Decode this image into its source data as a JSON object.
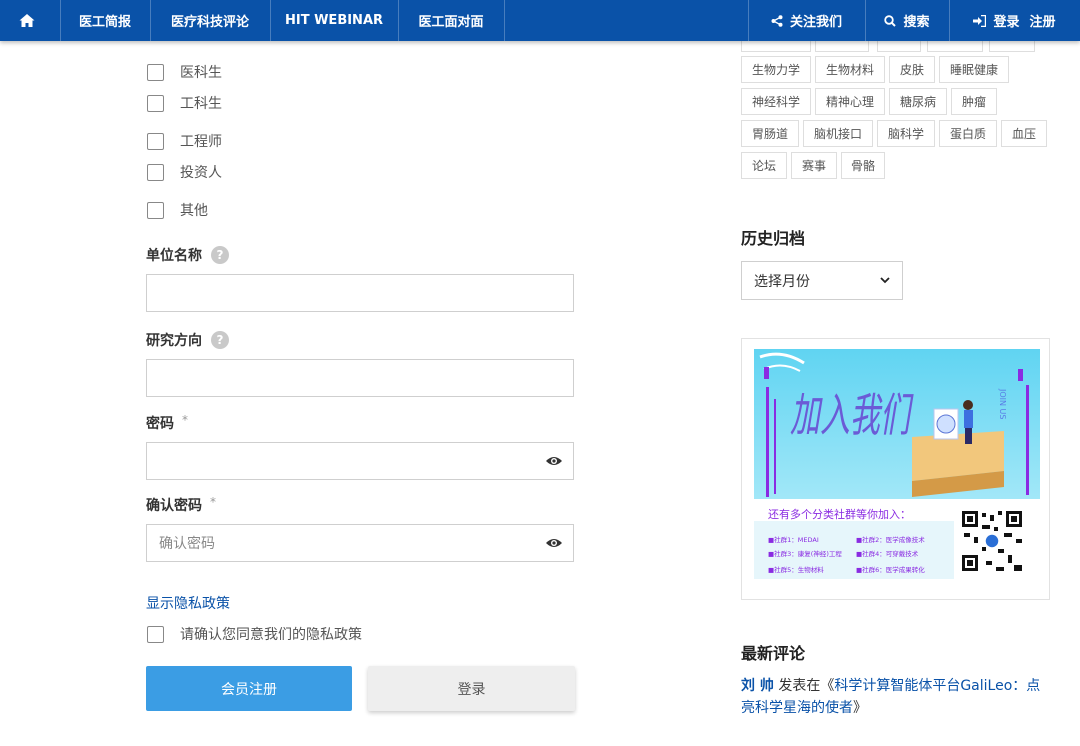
{
  "nav": {
    "home_icon": "home-icon",
    "items": [
      "医工简报",
      "医疗科技评论",
      "HIT WEBINAR",
      "医工面对面"
    ],
    "follow": "关注我们",
    "search": "搜索",
    "login": "登录",
    "register": "注册"
  },
  "form": {
    "roles": [
      "医科生",
      "工科生",
      "工程师",
      "投资人",
      "其他"
    ],
    "org_label": "单位名称",
    "research_label": "研究方向",
    "password_label": "密码",
    "confirm_label": "确认密码",
    "required_mark": "*",
    "help_mark": "?",
    "confirm_placeholder": "确认密码",
    "privacy_link": "显示隐私政策",
    "privacy_consent": "请确认您同意我们的隐私政策",
    "register_button": "会员注册",
    "login_button": "登录"
  },
  "sidebar": {
    "tags_row0": [
      "",
      "",
      "",
      "",
      ""
    ],
    "tags": [
      "生物力学",
      "生物材料",
      "皮肤",
      "睡眠健康",
      "神经科学",
      "精神心理",
      "糖尿病",
      "肿瘤",
      "胃肠道",
      "脑机接口",
      "脑科学",
      "蛋白质",
      "血压",
      "论坛",
      "赛事",
      "骨骼"
    ],
    "archive_title": "历史归档",
    "archive_select": "选择月份",
    "promo": {
      "headline": "加入我们",
      "join_us": "JOIN US",
      "subtitle": "还有多个分类社群等你加入：",
      "groups": [
        "■社群1：MEDAI",
        "■社群2：医学成像技术",
        "■社群3：康复(神经)工程",
        "■社群4：可穿戴技术",
        "■社群5：生物材料",
        "■社群6：医学成果转化"
      ]
    },
    "comments_title": "最新评论",
    "comment": {
      "author": "刘 帅",
      "text": " 发表在《",
      "post": "科学计算智能体平台GaliLeo：点亮科学星海的使者",
      "close": "》"
    }
  }
}
